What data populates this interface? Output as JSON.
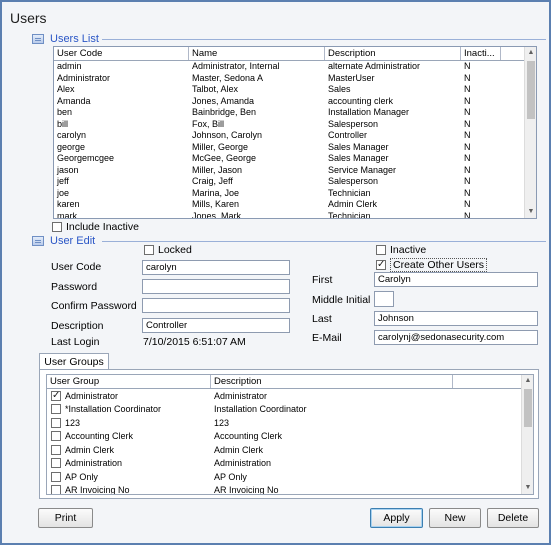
{
  "window": {
    "title": "Users"
  },
  "users_list": {
    "title": "Users List",
    "columns": [
      "User Code",
      "Name",
      "Description",
      "Inacti..."
    ],
    "rows": [
      [
        "admin",
        "Administrator, Internal",
        "alternate Administratior",
        "N"
      ],
      [
        "Administrator",
        "Master, Sedona A",
        "MasterUser",
        "N"
      ],
      [
        "Alex",
        "Talbot, Alex",
        "Sales",
        "N"
      ],
      [
        "Amanda",
        "Jones, Amanda",
        "accounting clerk",
        "N"
      ],
      [
        "ben",
        "Bainbridge, Ben",
        "Installation Manager",
        "N"
      ],
      [
        "bill",
        "Fox, Bill",
        "Salesperson",
        "N"
      ],
      [
        "carolyn",
        "Johnson, Carolyn",
        "Controller",
        "N"
      ],
      [
        "george",
        "Miller, George",
        "Sales Manager",
        "N"
      ],
      [
        "Georgemcgee",
        "McGee, George",
        "Sales Manager",
        "N"
      ],
      [
        "jason",
        "Miller, Jason",
        "Service Manager",
        "N"
      ],
      [
        "jeff",
        "Craig, Jeff",
        "Salesperson",
        "N"
      ],
      [
        "joe",
        "Marina, Joe",
        "Technician",
        "N"
      ],
      [
        "karen",
        "Mills, Karen",
        "Admin Clerk",
        "N"
      ],
      [
        "mark",
        "Jones, Mark",
        "Technician",
        "N"
      ]
    ],
    "include_inactive_label": "Include Inactive",
    "include_inactive_checked": false
  },
  "user_edit": {
    "title": "User Edit",
    "locked_label": "Locked",
    "locked_checked": false,
    "inactive_label": "Inactive",
    "inactive_checked": false,
    "create_other_users_label": "Create Other Users",
    "create_other_users_checked": true,
    "user_code_label": "User Code",
    "user_code_value": "carolyn",
    "password_label": "Password",
    "password_value": "",
    "confirm_password_label": "Confirm Password",
    "confirm_password_value": "",
    "description_label": "Description",
    "description_value": "Controller",
    "last_login_label": "Last Login",
    "last_login_value": "7/10/2015 6:51:07 AM",
    "first_label": "First",
    "first_value": "Carolyn",
    "middle_initial_label": "Middle Initial",
    "middle_initial_value": "",
    "last_label": "Last",
    "last_value": "Johnson",
    "email_label": "E-Mail",
    "email_value": "carolynj@sedonasecurity.com"
  },
  "user_groups": {
    "tab_label": "User Groups",
    "columns": [
      "User Group",
      "Description"
    ],
    "rows": [
      {
        "checked": true,
        "group": "Administrator",
        "description": "Administrator"
      },
      {
        "checked": false,
        "group": "*Installation Coordinator",
        "description": "Installation Coordinator"
      },
      {
        "checked": false,
        "group": "123",
        "description": "123"
      },
      {
        "checked": false,
        "group": "Accounting Clerk",
        "description": "Accounting Clerk"
      },
      {
        "checked": false,
        "group": "Admin Clerk",
        "description": "Admin Clerk"
      },
      {
        "checked": false,
        "group": "Administration",
        "description": "Administration"
      },
      {
        "checked": false,
        "group": "AP Only",
        "description": "AP Only"
      },
      {
        "checked": false,
        "group": "AR Invoicing No",
        "description": "AR Invoicing No"
      }
    ]
  },
  "buttons": {
    "print": "Print",
    "apply": "Apply",
    "new": "New",
    "delete": "Delete"
  },
  "icons": {
    "section_icon": "list-icon",
    "scroll_up": "arrow-up-icon",
    "scroll_down": "arrow-down-icon"
  }
}
